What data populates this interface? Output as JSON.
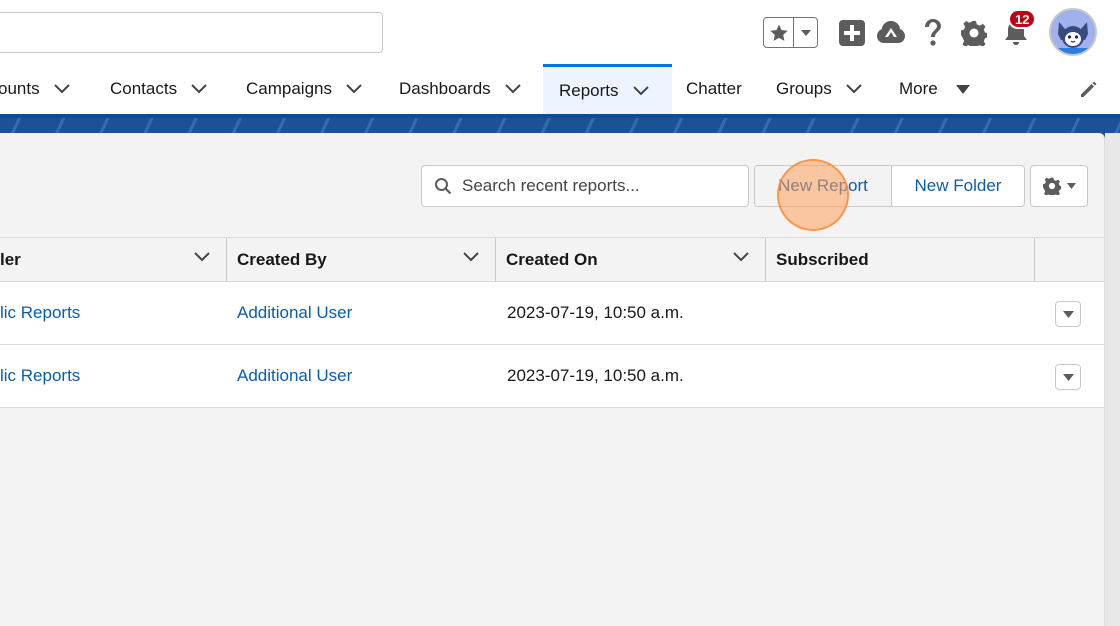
{
  "header": {
    "notifications_count": "12"
  },
  "nav": {
    "items": [
      {
        "label": "ounts"
      },
      {
        "label": "Contacts"
      },
      {
        "label": "Campaigns"
      },
      {
        "label": "Dashboards"
      },
      {
        "label": "Reports",
        "active": true
      },
      {
        "label": "Chatter"
      },
      {
        "label": "Groups"
      },
      {
        "label": "More"
      }
    ]
  },
  "toolbar": {
    "search_placeholder": "Search recent reports...",
    "new_report_label": "New Report",
    "new_folder_label": "New Folder"
  },
  "table": {
    "columns": [
      "ler",
      "Created By",
      "Created On",
      "Subscribed"
    ],
    "rows": [
      {
        "folder": "lic Reports",
        "created_by": "Additional User",
        "created_on": "2023-07-19, 10:50 a.m.",
        "subscribed": ""
      },
      {
        "folder": "lic Reports",
        "created_by": "Additional User",
        "created_on": "2023-07-19, 10:50 a.m.",
        "subscribed": ""
      }
    ]
  },
  "colors": {
    "brand_blue": "#0176d3",
    "link_blue": "#0b5cab",
    "banner_blue": "#1b5297",
    "badge_red": "#ba0517",
    "click_indicator": "#fda05a"
  }
}
